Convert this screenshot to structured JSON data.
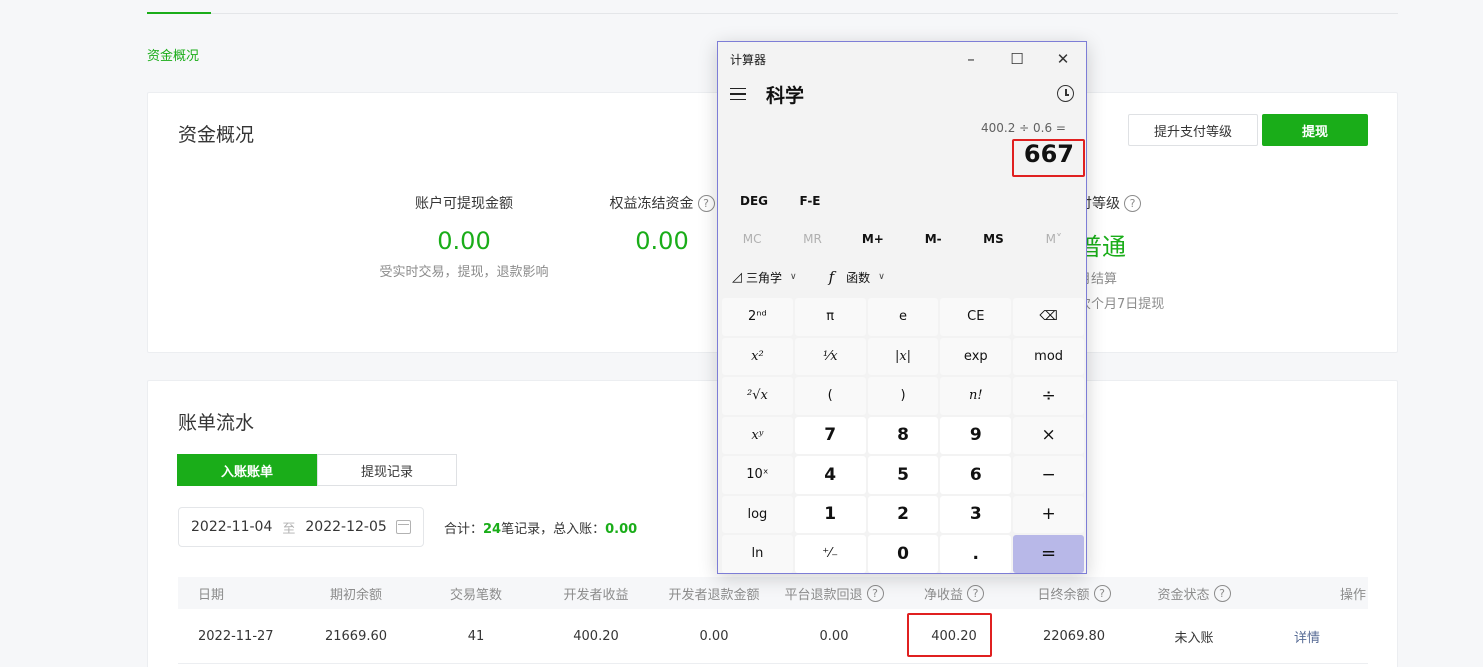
{
  "breadcrumb": "资金概况",
  "overview": {
    "title": "资金概况",
    "upgrade_button": "提升支付等级",
    "withdraw_button": "提现",
    "withdrawable": {
      "label": "账户可提现金额",
      "value": "0.00",
      "note": "受实时交易，提现，退款影响"
    },
    "frozen": {
      "label": "权益冻结资金",
      "value": "0.00"
    },
    "level": {
      "label": "付等级",
      "value": "普通",
      "note1": "月结算",
      "note2": "次个月7日提现"
    }
  },
  "bill": {
    "title": "账单流水",
    "tabs": [
      "入账账单",
      "提现记录"
    ],
    "date_start": "2022-11-04",
    "date_sep": "至",
    "date_end": "2022-12-05",
    "summary": {
      "prefix": "合计：",
      "count": "24",
      "count_suffix": "笔记录，总入账：",
      "total": "0.00"
    },
    "columns": [
      "日期",
      "期初余额",
      "交易笔数",
      "开发者收益",
      "开发者退款金额",
      "平台退款回退",
      "净收益",
      "日终余额",
      "资金状态",
      "操作"
    ],
    "rows": [
      {
        "date": "2022-11-27",
        "opening": "21669.60",
        "count": "41",
        "dev_income": "400.20",
        "dev_refund": "0.00",
        "platform_refund": "0.00",
        "net": "400.20",
        "closing": "22069.80",
        "status": "未入账",
        "action": "详情"
      }
    ]
  },
  "calculator": {
    "window_title": "计算器",
    "mode": "科学",
    "expression": "400.2 ÷ 0.6 =",
    "result": "667",
    "angle_buttons": [
      "DEG",
      "F-E"
    ],
    "memory_buttons": [
      "MC",
      "MR",
      "M+",
      "M-",
      "MS",
      "M˅"
    ],
    "trig_label": "三角学",
    "func_label": "函数",
    "keys": [
      "2ⁿᵈ",
      "π",
      "e",
      "CE",
      "⌫",
      "x²",
      "¹⁄x",
      "|x|",
      "exp",
      "mod",
      "²√x",
      "(",
      ")",
      "n!",
      "÷",
      "xʸ",
      "7",
      "8",
      "9",
      "×",
      "10ˣ",
      "4",
      "5",
      "6",
      "−",
      "log",
      "1",
      "2",
      "3",
      "+",
      "ln",
      "⁺⁄₋",
      "0",
      ".",
      "="
    ]
  },
  "accent_color": "#1aad19",
  "highlight_color": "#e02020"
}
